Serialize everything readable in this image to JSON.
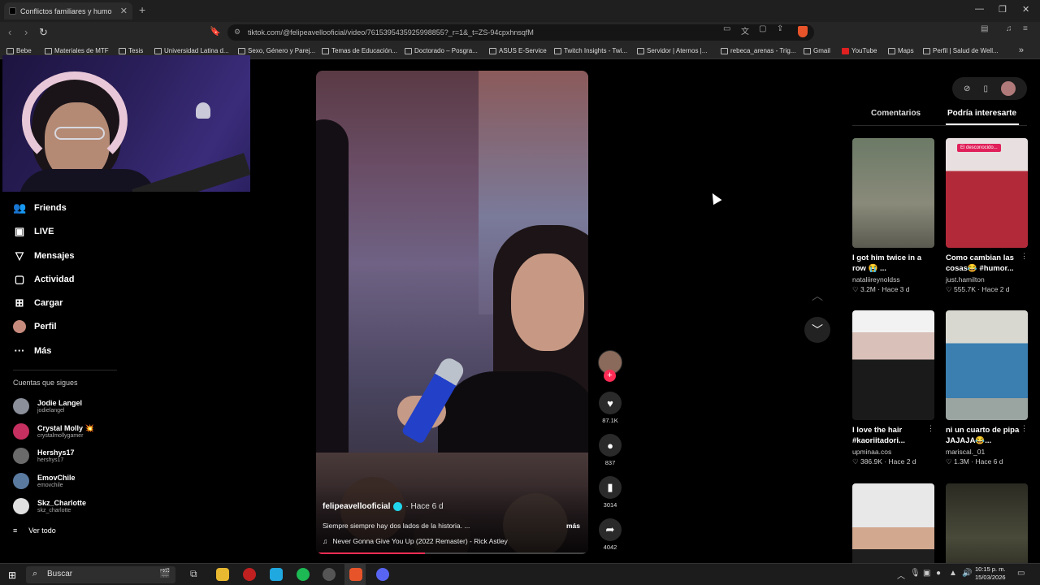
{
  "browser": {
    "tab_title": "Conflictos familiares y humo",
    "new_tab": "+",
    "url": "tiktok.com/@felipeavellooficial/video/7615395435925998855?_r=1&_t=ZS-94cpxhnsqfM",
    "bookmarks": [
      "Bebe",
      "Materiales de MTF",
      "Tesis",
      "Universidad Latina d...",
      "Sexo, Género y Parej...",
      "Temas de Educación...",
      "Doctorado – Posgra...",
      "ASUS E-Service",
      "Twitch Insights - Twi...",
      "Servidor | Aternos |...",
      "rebeca_arenas - Trig...",
      "Gmail",
      "YouTube",
      "Maps",
      "Perfil | Salud de Well..."
    ]
  },
  "sidebar": {
    "items": [
      {
        "label": "Friends",
        "icon": "friends-icon"
      },
      {
        "label": "LIVE",
        "icon": "live-icon"
      },
      {
        "label": "Mensajes",
        "icon": "messages-icon"
      },
      {
        "label": "Actividad",
        "icon": "activity-icon"
      },
      {
        "label": "Cargar",
        "icon": "upload-icon"
      },
      {
        "label": "Perfil",
        "icon": "profile-avatar"
      },
      {
        "label": "Más",
        "icon": "more-icon"
      }
    ],
    "following_title": "Cuentas que sigues",
    "following": [
      {
        "name": "Jodie Langel",
        "handle": "jodielangel",
        "color": "#8a8f9a"
      },
      {
        "name": "Crystal Molly 💥",
        "handle": "crystalmollygamer",
        "color": "#c53060"
      },
      {
        "name": "Hershys17",
        "handle": "hershys17",
        "color": "#6a6a6a"
      },
      {
        "name": "EmovChile",
        "handle": "emovchile",
        "color": "#5a7aa0"
      },
      {
        "name": "Skz_Charlotte",
        "handle": "skz_charlotte",
        "color": "#e0e0e0"
      }
    ],
    "see_all": "Ver todo"
  },
  "video": {
    "author": "felipeavellooficial",
    "time": "· Hace 6 d",
    "description": "Siempre siempre hay dos lados de la historia. ...",
    "more": "más",
    "music": "Never Gonna Give You Up (2022 Remaster) - Rick Astley",
    "progress": 0.4
  },
  "actions": {
    "likes": "87.1K",
    "comments": "837",
    "saves": "3014",
    "shares": "4042"
  },
  "right_panel": {
    "tabs": [
      "Comentarios",
      "Podría interesarte"
    ],
    "thumb_overlay_text": "El desconocido...",
    "cards": [
      {
        "caption": "I got him twice in a row 😭 ...",
        "user": "nataliireynoldss",
        "views": "♡ 3.2M",
        "age": "· Hace 3 d",
        "color": "#6b7a66"
      },
      {
        "caption": "Como cambian las cosas😂 #humor...",
        "user": "just.hamilton",
        "views": "♡ 555.7K",
        "age": "· Hace 2 d",
        "color": "#b22a3a"
      },
      {
        "caption": "I love the hair #kaoriitadori...",
        "user": "upminaa.cos",
        "views": "♡ 386.9K",
        "age": "· Hace 2 d",
        "color": "#3a3a3e"
      },
      {
        "caption": "ni un cuarto de pipa JAJAJA😂...",
        "user": "mariscal._01",
        "views": "♡ 1.3M",
        "age": "· Hace 6 d",
        "color": "#3a7fb0"
      },
      {
        "caption": "",
        "user": "",
        "views": "",
        "age": "",
        "color": "#d8d8d8"
      },
      {
        "caption": "",
        "user": "",
        "views": "",
        "age": "",
        "color": "#3a3a2e"
      }
    ]
  },
  "taskbar": {
    "search_placeholder": "Buscar",
    "time": "10:15 p. m.",
    "date": "15/03/2026"
  }
}
